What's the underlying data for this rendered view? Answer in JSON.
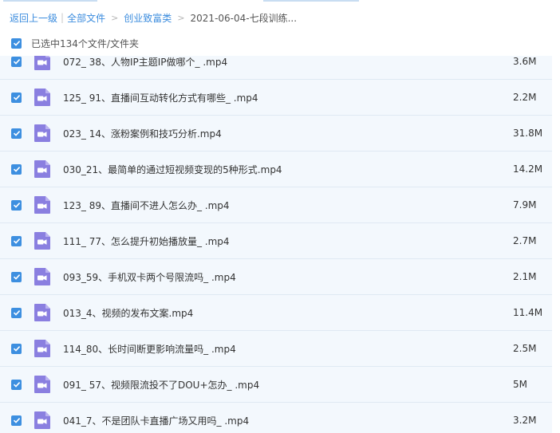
{
  "breadcrumb": {
    "back": "返回上一级",
    "all_files": "全部文件",
    "folder": "创业致富类",
    "current": "2021-06-04-七段训练..."
  },
  "selection": {
    "label": "已选中134个文件/文件夹"
  },
  "files": [
    {
      "name": "072_ 38、人物IP主题IP做哪个_ .mp4",
      "size": "3.6M"
    },
    {
      "name": "125_ 91、直播间互动转化方式有哪些_ .mp4",
      "size": "2.2M"
    },
    {
      "name": "023_ 14、涨粉案例和技巧分析.mp4",
      "size": "31.8M"
    },
    {
      "name": "030_21、最简单的通过短视频变现的5种形式.mp4",
      "size": "14.2M"
    },
    {
      "name": "123_ 89、直播间不进人怎么办_ .mp4",
      "size": "7.9M"
    },
    {
      "name": "111_ 77、怎么提升初始播放量_ .mp4",
      "size": "2.7M"
    },
    {
      "name": "093_59、手机双卡两个号限流吗_ .mp4",
      "size": "2.1M"
    },
    {
      "name": "013_4、视频的发布文案.mp4",
      "size": "11.4M"
    },
    {
      "name": "114_80、长时间断更影响流量吗_ .mp4",
      "size": "2.5M"
    },
    {
      "name": "091_ 57、视频限流投不了DOU+怎办_ .mp4",
      "size": "5M"
    },
    {
      "name": "041_7、不是团队卡直播广场又用吗_ .mp4",
      "size": "3.2M"
    }
  ],
  "colors": {
    "accent": "#3d8fe0",
    "link": "#3b8cde",
    "row_bg": "#f3f8fd",
    "video_icon": "#8a7fe0"
  },
  "icons": {
    "checkbox": "checkmark-icon",
    "file": "video-file-icon"
  }
}
